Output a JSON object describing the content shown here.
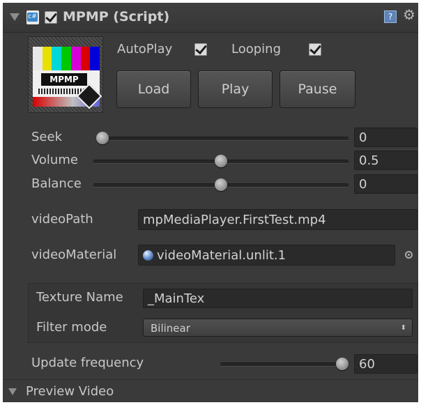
{
  "header": {
    "title": "MPMP (Script)",
    "script_icon_glyph": "c#"
  },
  "controls": {
    "autoplay_label": "AutoPlay",
    "autoplay_checked": true,
    "looping_label": "Looping",
    "looping_checked": true,
    "load_label": "Load",
    "play_label": "Play",
    "pause_label": "Pause"
  },
  "thumbnail": {
    "logo_text": "MPMP"
  },
  "sliders": {
    "seek": {
      "label": "Seek",
      "value": "0",
      "fraction": 0.0
    },
    "volume": {
      "label": "Volume",
      "value": "0.5",
      "fraction": 0.5
    },
    "balance": {
      "label": "Balance",
      "value": "0",
      "fraction": 0.5
    }
  },
  "fields": {
    "video_path_label": "videoPath",
    "video_path_value": "mpMediaPlayer.FirstTest.mp4",
    "video_material_label": "videoMaterial",
    "video_material_value": "videoMaterial.unlit.1"
  },
  "texture": {
    "name_label": "Texture Name",
    "name_value": "_MainTex",
    "filter_label": "Filter mode",
    "filter_value": "Bilinear"
  },
  "update_frequency": {
    "label": "Update frequency",
    "value": "60",
    "fraction": 1.0
  },
  "preview": {
    "label": "Preview Video"
  },
  "colors": {
    "panel_bg": "#3a3a3a",
    "field_bg": "#2a2a2a",
    "text": "#c8c8c8"
  }
}
